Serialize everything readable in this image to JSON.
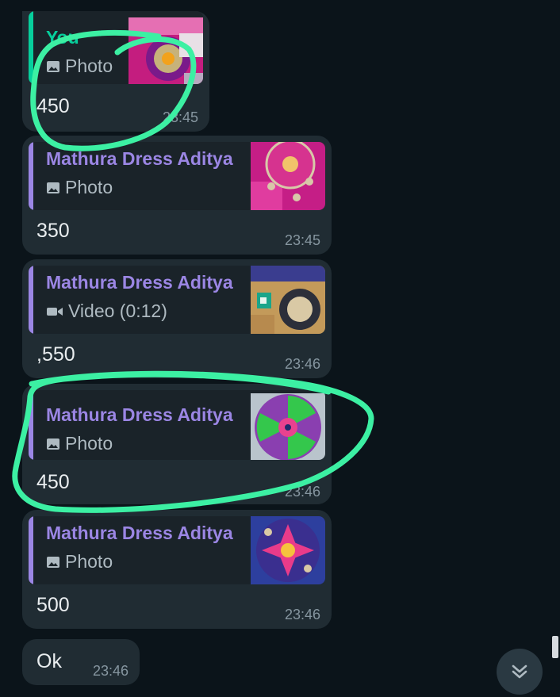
{
  "messages": [
    {
      "quote_sender": "You",
      "quote_media": "Photo",
      "quote_media_type": "photo",
      "body": "450",
      "time": "23:45",
      "sent": true
    },
    {
      "quote_sender": "Mathura Dress Aditya",
      "quote_media": "Photo",
      "quote_media_type": "photo",
      "body": "350",
      "time": "23:45"
    },
    {
      "quote_sender": "Mathura Dress Aditya",
      "quote_media": "Video (0:12)",
      "quote_media_type": "video",
      "body": ",550",
      "time": "23:46"
    },
    {
      "quote_sender": "Mathura Dress Aditya",
      "quote_media": "Photo",
      "quote_media_type": "photo",
      "body": "450",
      "time": "23:46"
    },
    {
      "quote_sender": "Mathura Dress Aditya",
      "quote_media": "Photo",
      "quote_media_type": "photo",
      "body": "500",
      "time": "23:46"
    },
    {
      "body": "Ok",
      "time": "23:46"
    }
  ],
  "colors": {
    "background": "#0b141a",
    "bubble": "#202c33",
    "quote_bar_you": "#06cf9c",
    "quote_bar_other": "#9b86e4",
    "sender_name": "#9b86e4",
    "time": "#8696a0",
    "annotation": "#3cf0a3"
  },
  "icons": {
    "photo": "image-icon",
    "video": "video-camera-icon",
    "scroll_down": "double-chevron-down-icon"
  }
}
